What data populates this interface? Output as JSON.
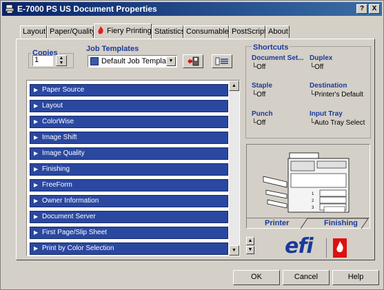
{
  "window": {
    "title": "E-7000 PS US Document Properties"
  },
  "titlebar_buttons": {
    "help": "?",
    "close": "X"
  },
  "tabs": [
    {
      "label": "Layout"
    },
    {
      "label": "Paper/Quality"
    },
    {
      "label": "Fiery Printing",
      "active": true
    },
    {
      "label": "Statistics"
    },
    {
      "label": "Consumables"
    },
    {
      "label": "PostScript"
    },
    {
      "label": "About"
    }
  ],
  "copies": {
    "label": "Copies",
    "value": "1"
  },
  "job_templates": {
    "label": "Job Templates",
    "selected": "Default Job Template"
  },
  "sections": [
    "Paper Source",
    "Layout",
    "ColorWise",
    "Image Shift",
    "Image Quality",
    "Finishing",
    "FreeForm",
    "Owner Information",
    "Document Server",
    "First Page/Slip Sheet",
    "Print by Color Selection"
  ],
  "shortcuts": {
    "label": "Shortcuts",
    "items": [
      {
        "name": "Document Set...",
        "value": "Off"
      },
      {
        "name": "Duplex",
        "value": "Off"
      },
      {
        "name": "Staple",
        "value": "Off"
      },
      {
        "name": "Destination",
        "value": "Printer's Default"
      },
      {
        "name": "Punch",
        "value": "Off"
      },
      {
        "name": "Input Tray",
        "value": "Auto Tray Select"
      }
    ]
  },
  "preview": {
    "tab_printer": "Printer",
    "tab_finishing": "Finishing",
    "tray_labels": [
      "1",
      "2",
      "3"
    ]
  },
  "logo": {
    "text": "efi"
  },
  "buttons": {
    "ok": "OK",
    "cancel": "Cancel",
    "help": "Help"
  },
  "colors": {
    "accent": "#1a3a9a",
    "row_bg": "#2a48a0",
    "title_start": "#0a246a",
    "title_end": "#3a6ea5",
    "fiery_red": "#dd1111"
  },
  "icons": {
    "app": "printer-icon",
    "section_row": "triangle-right-icon",
    "fiery_tab": "fiery-flame-icon"
  }
}
